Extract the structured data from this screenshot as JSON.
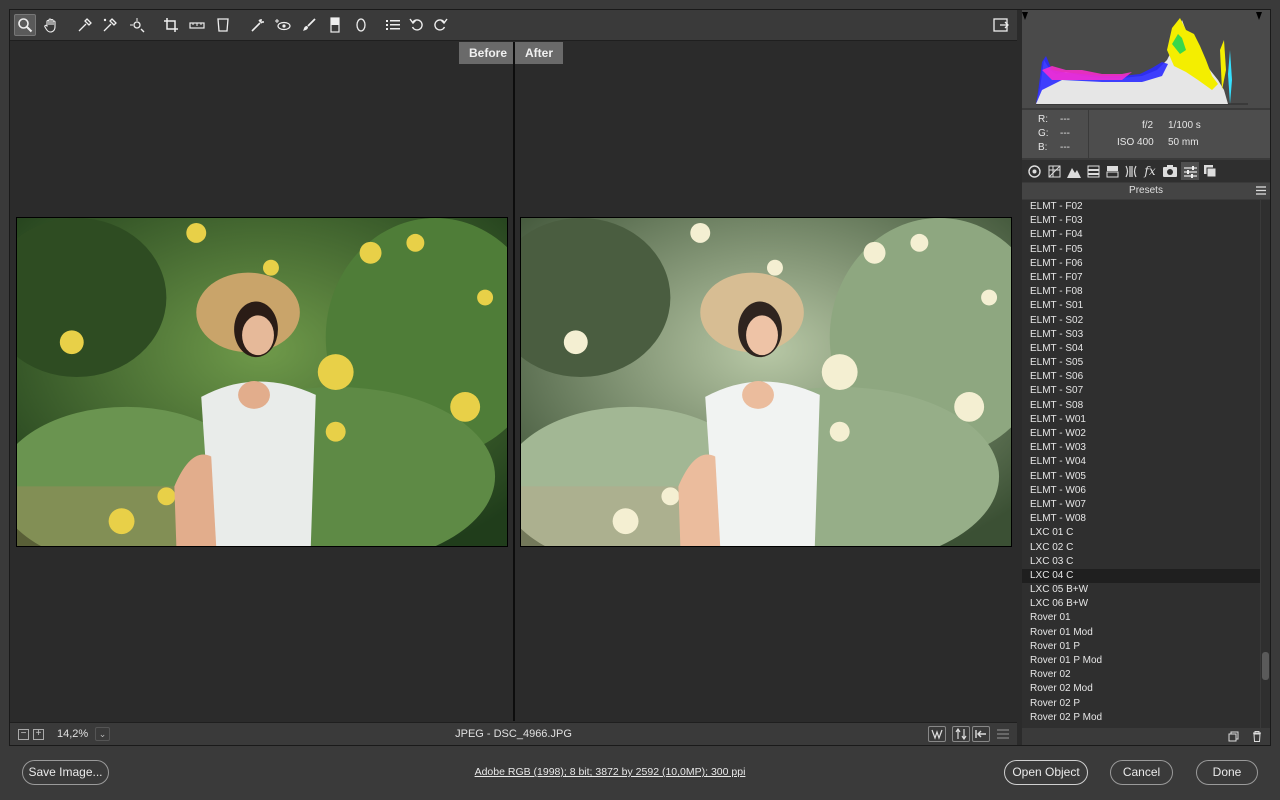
{
  "toolbar": {
    "tools": [
      "zoom-icon",
      "hand-icon",
      "white-balance-icon",
      "color-sampler-icon",
      "targeted-adjustment-icon",
      "crop-icon",
      "straighten-icon",
      "transform-icon",
      "spot-removal-icon",
      "red-eye-icon",
      "adjustment-brush-icon",
      "graduated-filter-icon",
      "radial-filter-icon",
      "preferences-icon",
      "rotate-left-icon",
      "rotate-right-icon"
    ],
    "active_tool": "zoom-icon"
  },
  "viewer": {
    "before_label": "Before",
    "after_label": "After"
  },
  "statusbar": {
    "zoom": "14,2%",
    "file": "JPEG  -  DSC_4966.JPG"
  },
  "info": {
    "r_label": "R:",
    "r_value": "---",
    "g_label": "G:",
    "g_value": "---",
    "b_label": "B:",
    "b_value": "---",
    "aperture": "f/2",
    "shutter": "1/100 s",
    "iso": "ISO 400",
    "focal": "50 mm"
  },
  "presets": {
    "header": "Presets",
    "items": [
      "ELMT - F02",
      "ELMT - F03",
      "ELMT - F04",
      "ELMT - F05",
      "ELMT - F06",
      "ELMT - F07",
      "ELMT - F08",
      "ELMT - S01",
      "ELMT - S02",
      "ELMT - S03",
      "ELMT - S04",
      "ELMT - S05",
      "ELMT - S06",
      "ELMT - S07",
      "ELMT - S08",
      "ELMT - W01",
      "ELMT - W02",
      "ELMT - W03",
      "ELMT - W04",
      "ELMT - W05",
      "ELMT - W06",
      "ELMT - W07",
      "ELMT - W08",
      "LXC 01 C",
      "LXC 02 C",
      "LXC 03 C",
      "LXC 04 C",
      "LXC 05 B+W",
      "LXC 06 B+W",
      "Rover 01",
      "Rover 01 Mod",
      "Rover 01 P",
      "Rover 01 P Mod",
      "Rover 02",
      "Rover 02 Mod",
      "Rover 02 P",
      "Rover 02 P Mod"
    ],
    "selected": "LXC 04 C"
  },
  "footer": {
    "save_label": "Save Image...",
    "workflow": "Adobe RGB (1998); 8 bit; 3872 by 2592 (10,0MP); 300 ppi",
    "open_label": "Open Object",
    "cancel_label": "Cancel",
    "done_label": "Done"
  }
}
